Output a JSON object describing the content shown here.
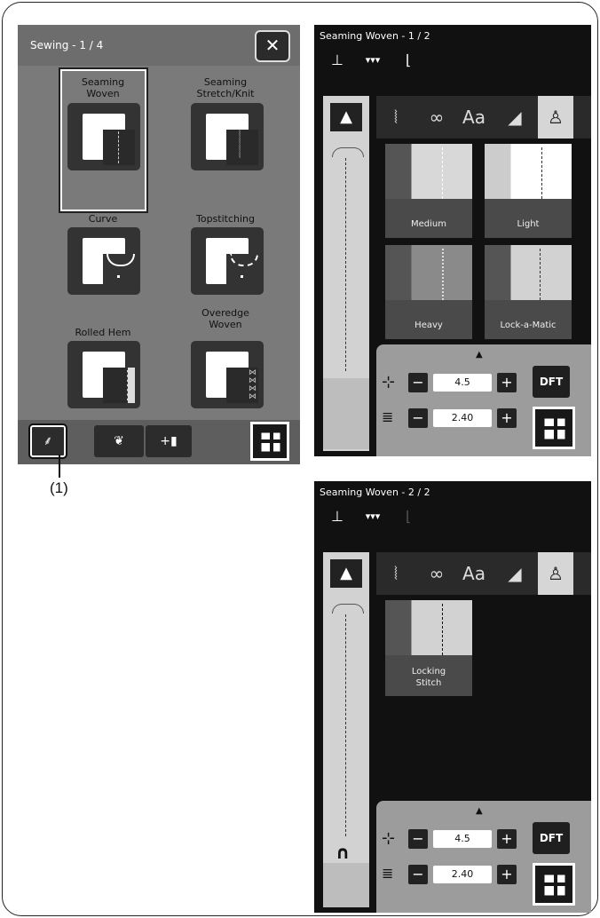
{
  "left_panel": {
    "title": "Sewing - 1 / 4",
    "close_label": "✕",
    "modes": [
      {
        "label": "Seaming\nWoven"
      },
      {
        "label": "Seaming\nStretch/Knit"
      },
      {
        "label": "Curve"
      },
      {
        "label": "Topstitching"
      },
      {
        "label": "Rolled Hem"
      },
      {
        "label": "Overedge\nWoven"
      }
    ],
    "footer_tabs": [
      "⸙",
      "❦",
      "+▮"
    ]
  },
  "callout_label": "(1)",
  "top_panel": {
    "title": "Seaming Woven - 1 / 2",
    "cards": [
      {
        "label": "Medium"
      },
      {
        "label": "Light"
      },
      {
        "label": "Heavy"
      },
      {
        "label": "Lock-a-Matic"
      }
    ],
    "width_value": "4.5",
    "length_value": "2.40",
    "dft_label": "DFT",
    "tab_aa": "Aa"
  },
  "bottom_panel": {
    "title": "Seaming Woven - 2 / 2",
    "cards": [
      {
        "label": "Locking\nStitch"
      }
    ],
    "width_value": "4.5",
    "length_value": "2.40",
    "dft_label": "DFT",
    "tab_aa": "Aa"
  },
  "colors": {
    "panel_gray": "#7a7a7a",
    "screen_black": "#111111",
    "control_gray": "#9c9c9c"
  }
}
